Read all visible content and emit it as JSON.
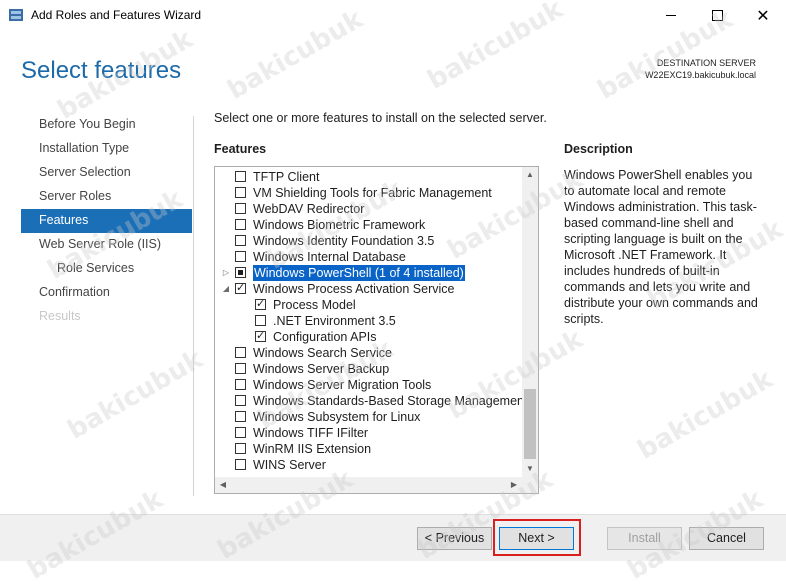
{
  "window": {
    "title": "Add Roles and Features Wizard",
    "controls": {
      "minimize": "minimize",
      "maximize": "maximize",
      "close": "close"
    }
  },
  "header": {
    "page_title": "Select features",
    "destination_label": "DESTINATION SERVER",
    "destination_server": "W22EXC19.bakicubuk.local"
  },
  "nav": {
    "items": [
      {
        "label": "Before You Begin",
        "state": "normal"
      },
      {
        "label": "Installation Type",
        "state": "normal"
      },
      {
        "label": "Server Selection",
        "state": "normal"
      },
      {
        "label": "Server Roles",
        "state": "normal"
      },
      {
        "label": "Features",
        "state": "active"
      },
      {
        "label": "Web Server Role (IIS)",
        "state": "normal"
      },
      {
        "label": "Role Services",
        "state": "sub"
      },
      {
        "label": "Confirmation",
        "state": "normal"
      },
      {
        "label": "Results",
        "state": "disabled"
      }
    ]
  },
  "main": {
    "intro": "Select one or more features to install on the selected server.",
    "features_label": "Features",
    "features": [
      {
        "label": "TFTP Client",
        "check": "none",
        "level": 0
      },
      {
        "label": "VM Shielding Tools for Fabric Management",
        "check": "none",
        "level": 0
      },
      {
        "label": "WebDAV Redirector",
        "check": "none",
        "level": 0
      },
      {
        "label": "Windows Biometric Framework",
        "check": "none",
        "level": 0
      },
      {
        "label": "Windows Identity Foundation 3.5",
        "check": "none",
        "level": 0
      },
      {
        "label": "Windows Internal Database",
        "check": "none",
        "level": 0
      },
      {
        "label": "Windows PowerShell (1 of 4 installed)",
        "check": "partial",
        "level": 0,
        "expander": "collapsed",
        "selected": true
      },
      {
        "label": "Windows Process Activation Service",
        "check": "checked",
        "level": 0,
        "expander": "expanded"
      },
      {
        "label": "Process Model",
        "check": "checked",
        "level": 1
      },
      {
        "label": ".NET Environment 3.5",
        "check": "none",
        "level": 1
      },
      {
        "label": "Configuration APIs",
        "check": "checked",
        "level": 1
      },
      {
        "label": "Windows Search Service",
        "check": "none",
        "level": 0
      },
      {
        "label": "Windows Server Backup",
        "check": "none",
        "level": 0
      },
      {
        "label": "Windows Server Migration Tools",
        "check": "none",
        "level": 0
      },
      {
        "label": "Windows Standards-Based Storage Management",
        "check": "none",
        "level": 0
      },
      {
        "label": "Windows Subsystem for Linux",
        "check": "none",
        "level": 0
      },
      {
        "label": "Windows TIFF IFilter",
        "check": "none",
        "level": 0
      },
      {
        "label": "WinRM IIS Extension",
        "check": "none",
        "level": 0
      },
      {
        "label": "WINS Server",
        "check": "none",
        "level": 0
      }
    ],
    "description_label": "Description",
    "description_text": "Windows PowerShell enables you to automate local and remote Windows administration. This task-based command-line shell and scripting language is built on the Microsoft .NET Framework. It includes hundreds of built-in commands and lets you write and distribute your own commands and scripts."
  },
  "footer": {
    "previous": "< Previous",
    "next": "Next >",
    "install": "Install",
    "cancel": "Cancel"
  },
  "watermark": "bakicubuk",
  "icons": {
    "app": "server-manager-icon",
    "scroll_up": "scroll-up-arrow-icon",
    "scroll_down": "scroll-down-arrow-icon",
    "scroll_left": "scroll-left-arrow-icon",
    "scroll_right": "scroll-right-arrow-icon"
  },
  "colors": {
    "accent": "#1b6fb7",
    "title": "#1c6aa9",
    "selection": "#0a64c8",
    "highlight_box": "#d9201e"
  }
}
